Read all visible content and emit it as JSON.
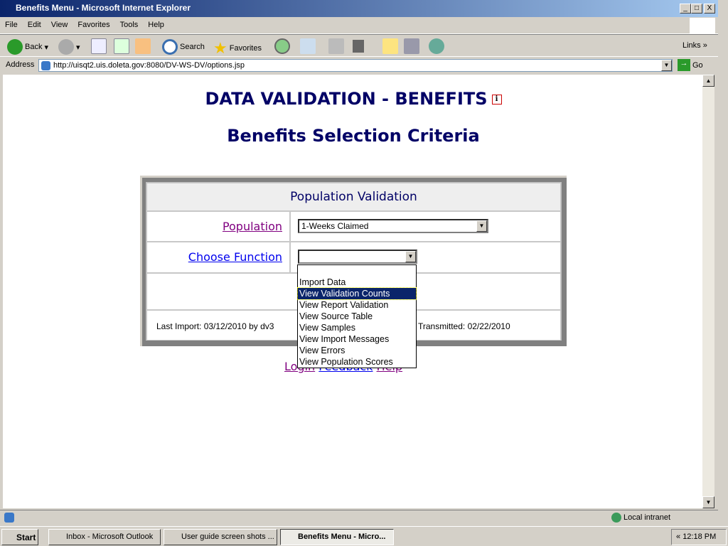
{
  "window": {
    "title": "Benefits Menu - Microsoft Internet Explorer"
  },
  "menu": [
    "File",
    "Edit",
    "View",
    "Favorites",
    "Tools",
    "Help"
  ],
  "toolbar": {
    "back": "Back",
    "search": "Search",
    "favorites": "Favorites",
    "links": "Links"
  },
  "address": {
    "label": "Address",
    "url": "http://uisqt2.uis.doleta.gov:8080/DV-WS-DV/options.jsp",
    "go": "Go"
  },
  "page": {
    "title": "DATA VALIDATION - BENEFITS",
    "info_icon": "i",
    "subtitle": "Benefits Selection Criteria"
  },
  "panel": {
    "header": "Population Validation",
    "population_label": "Population",
    "population_value": "1-Weeks Claimed",
    "function_label": "Choose Function",
    "function_value": "",
    "last_import": "Last Import: 03/12/2010 by dv3",
    "transmitted": "Transmitted: 02/22/2010"
  },
  "dropdown": {
    "options": [
      "Import Data",
      "View Validation Counts",
      "View Report Validation",
      "View Source Table",
      "View Samples",
      "View Import Messages",
      "View Errors",
      "View Population Scores"
    ],
    "selected": "View Validation Counts",
    "highlight_color": "#0a246a"
  },
  "footer_links": [
    "Login",
    "Feedback",
    "Help"
  ],
  "status": {
    "zone": "Local intranet"
  },
  "taskbar": {
    "start": "Start",
    "tasks": [
      "Inbox - Microsoft Outlook",
      "User guide screen shots ...",
      "Benefits Menu - Micro..."
    ],
    "clock": "12:18 PM"
  }
}
